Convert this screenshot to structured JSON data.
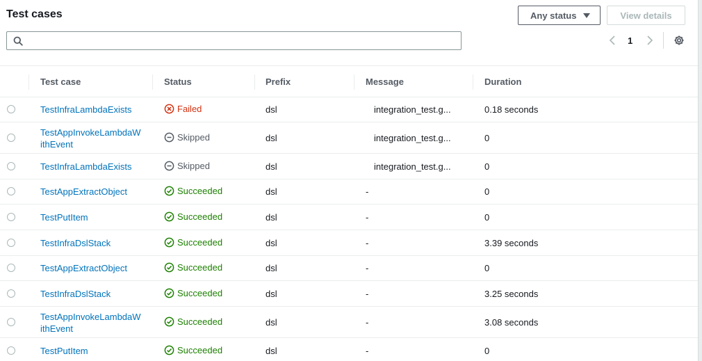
{
  "header": {
    "title": "Test cases",
    "status_filter": "Any status",
    "view_details": "View details"
  },
  "search": {
    "placeholder": ""
  },
  "pagination": {
    "current_page": "1"
  },
  "columns": {
    "test_case": "Test case",
    "status": "Status",
    "prefix": "Prefix",
    "message": "Message",
    "duration": "Duration"
  },
  "rows": [
    {
      "name": "TestInfraLambdaExists",
      "status": "Failed",
      "status_icon": "failed-x-icon",
      "prefix": "dsl",
      "message": "integration_test.g...",
      "duration": "0.18 seconds"
    },
    {
      "name": "TestAppInvokeLambdaWithEvent",
      "name_line1": "TestAppInvokeLambdaW",
      "name_line2": "ithEvent",
      "status": "Skipped",
      "status_icon": "skipped-minus-icon",
      "prefix": "dsl",
      "message": "integration_test.g...",
      "duration": "0"
    },
    {
      "name": "TestInfraLambdaExists",
      "status": "Skipped",
      "status_icon": "skipped-minus-icon",
      "prefix": "dsl",
      "message": "integration_test.g...",
      "duration": "0"
    },
    {
      "name": "TestAppExtractObject",
      "status": "Succeeded",
      "status_icon": "success-check-icon",
      "prefix": "dsl",
      "message": "-",
      "duration": "0"
    },
    {
      "name": "TestPutItem",
      "status": "Succeeded",
      "status_icon": "success-check-icon",
      "prefix": "dsl",
      "message": "-",
      "duration": "0"
    },
    {
      "name": "TestInfraDslStack",
      "status": "Succeeded",
      "status_icon": "success-check-icon",
      "prefix": "dsl",
      "message": "-",
      "duration": "3.39 seconds"
    },
    {
      "name": "TestAppExtractObject",
      "status": "Succeeded",
      "status_icon": "success-check-icon",
      "prefix": "dsl",
      "message": "-",
      "duration": "0"
    },
    {
      "name": "TestInfraDslStack",
      "status": "Succeeded",
      "status_icon": "success-check-icon",
      "prefix": "dsl",
      "message": "-",
      "duration": "3.25 seconds"
    },
    {
      "name": "TestAppInvokeLambdaWithEvent",
      "name_line1": "TestAppInvokeLambdaW",
      "name_line2": "ithEvent",
      "status": "Succeeded",
      "status_icon": "success-check-icon",
      "prefix": "dsl",
      "message": "-",
      "duration": "3.08 seconds"
    },
    {
      "name": "TestPutItem",
      "status": "Succeeded",
      "status_icon": "success-check-icon",
      "prefix": "dsl",
      "message": "-",
      "duration": "0"
    }
  ],
  "colors": {
    "link": "#0073bb",
    "failed": "#d13212",
    "succeeded": "#1d8102",
    "skipped": "#545b64"
  }
}
